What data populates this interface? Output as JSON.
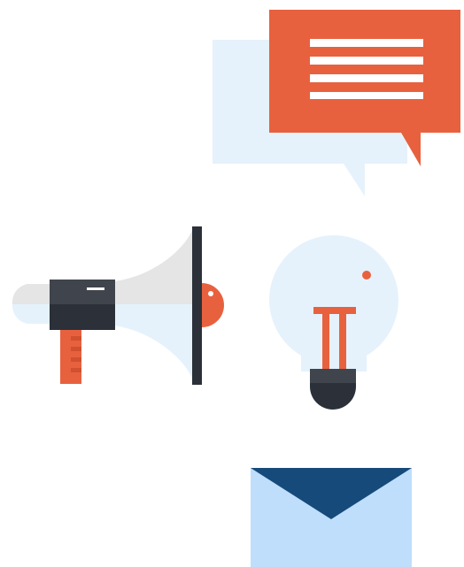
{
  "colors": {
    "background": "#ffffff",
    "light_blue": "#e5f2fc",
    "orange": "#e8613f",
    "dark": "#2b3039",
    "dark_gray": "#40454d",
    "light_gray": "#e5e5e5",
    "envelope_body": "#bfdefc",
    "envelope_flap": "#164a7a"
  },
  "icons": [
    "speech-bubbles-icon",
    "megaphone-icon",
    "lightbulb-icon",
    "envelope-icon"
  ]
}
